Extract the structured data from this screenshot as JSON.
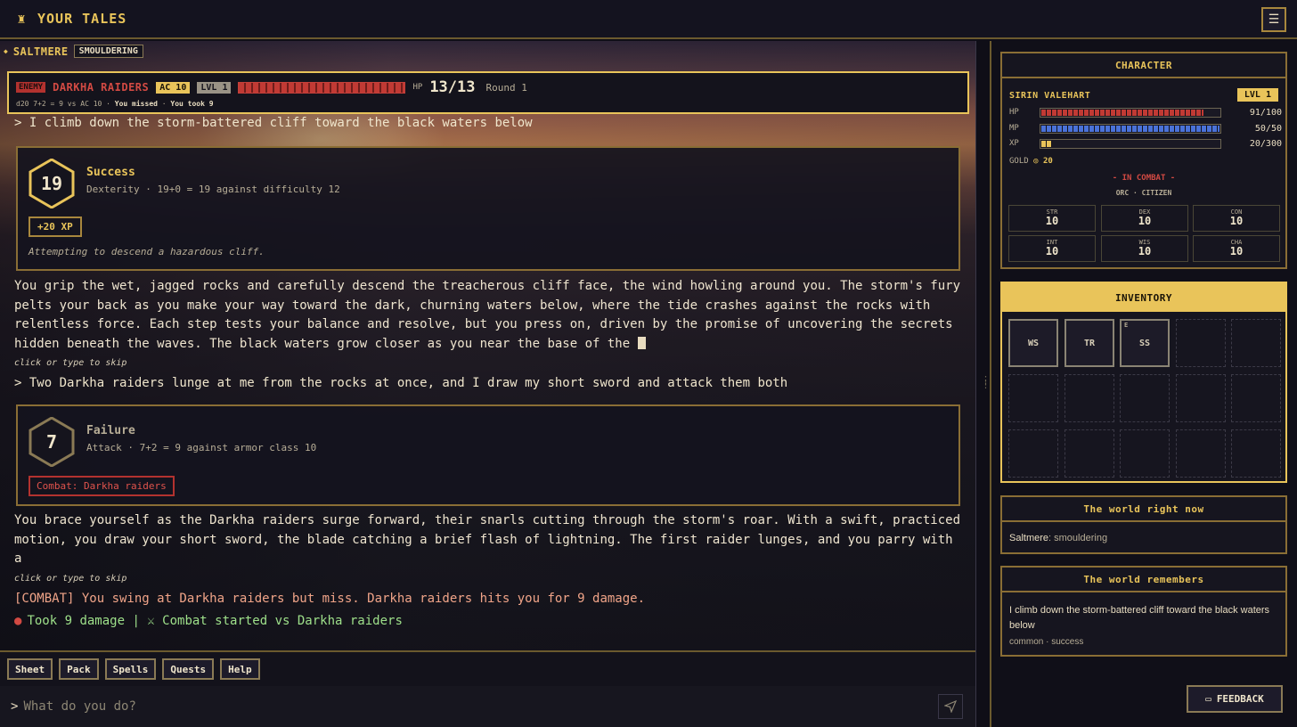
{
  "app": {
    "title": "YOUR TALES",
    "logo_icon": "adventurer-icon",
    "menu_icon": "hamburger-menu-icon"
  },
  "location": {
    "name": "SALTMERE",
    "status": "SMOULDERING"
  },
  "combat": {
    "enemy_tag": "ENEMY",
    "enemy_name": "DARKHA RAIDERS",
    "ac": "AC 10",
    "level": "LVL 1",
    "hp_label": "HP",
    "hp_value": "13/13",
    "hp_fraction": 1.0,
    "round": "Round 1",
    "roll_text": "d20 7+2 = 9 vs AC 10",
    "missed": "You missed",
    "took": "You took 9"
  },
  "feed": {
    "cmd1": "> I climb down the storm-battered cliff toward the black waters below",
    "check1": {
      "roll": "19",
      "result": "Success",
      "detail": "Dexterity · 19+0 = 19 against difficulty 12",
      "xp": "+20 XP",
      "attempt": "Attempting to descend a hazardous cliff."
    },
    "narr1": "You grip the wet, jagged rocks and carefully descend the treacherous cliff face, the wind howling around you. The storm's fury pelts your back as you make your way toward the dark, churning waters below, where the tide crashes against the rocks with relentless force. Each step tests your balance and resolve, but you press on, driven by the promise of uncovering the secrets hidden beneath the waves. The black waters grow closer as you near the base of the ",
    "skip": "click or type to skip",
    "cmd2": "> Two Darkha raiders lunge at me from the rocks at once, and I draw my short sword and attack them both",
    "check2": {
      "roll": "7",
      "result": "Failure",
      "detail": "Attack · 7+2 = 9 against armor class 10",
      "combat_chip": "Combat: Darkha raiders"
    },
    "narr2": "You brace yourself as the Darkha raiders surge forward, their snarls cutting through the storm's roar. With a swift, practiced motion, you draw your short sword, the blade catching a brief flash of lightning. The first raider lunges, and you parry with a",
    "log_combat": "[COMBAT] You swing at Darkha raiders but miss. Darkha raiders hits you for 9 damage.",
    "log_effects": "Took 9 damage | ⚔ Combat started vs Darkha raiders"
  },
  "actions": [
    "Sheet",
    "Pack",
    "Spells",
    "Quests",
    "Help"
  ],
  "input": {
    "prompt": ">",
    "placeholder": "What do you do?"
  },
  "character": {
    "panel_title": "CHARACTER",
    "name": "SIRIN VALEHART",
    "level": "LVL 1",
    "hp": {
      "label": "HP",
      "value": "91/100",
      "fraction": 0.91,
      "color": "#c13a34"
    },
    "mp": {
      "label": "MP",
      "value": "50/50",
      "fraction": 1.0,
      "color": "#4a72d8"
    },
    "xp": {
      "label": "XP",
      "value": "20/300",
      "fraction": 0.067,
      "color": "#e9c45a"
    },
    "gold_label": "GOLD",
    "gold_value": "◎ 20",
    "status": "- IN COMBAT -",
    "race_class": "ORC · CITIZEN",
    "abilities": [
      {
        "name": "STR",
        "value": "10"
      },
      {
        "name": "DEX",
        "value": "10"
      },
      {
        "name": "CON",
        "value": "10"
      },
      {
        "name": "INT",
        "value": "10"
      },
      {
        "name": "WIS",
        "value": "10"
      },
      {
        "name": "CHA",
        "value": "10"
      }
    ]
  },
  "inventory": {
    "title": "INVENTORY",
    "items": [
      "WS",
      "TR",
      "SS"
    ],
    "equipped_marker": "E"
  },
  "world_now": {
    "title": "The world right now",
    "place": "Saltmere",
    "state": ": smouldering"
  },
  "world_remembers": {
    "title": "The world remembers",
    "text": "I climb down the storm-battered cliff toward the black waters below",
    "meta": "common · success"
  },
  "feedback": {
    "label": "FEEDBACK"
  },
  "colors": {
    "accent": "#e9c45a",
    "danger": "#d24a43",
    "success_text": "#9ee08a"
  }
}
